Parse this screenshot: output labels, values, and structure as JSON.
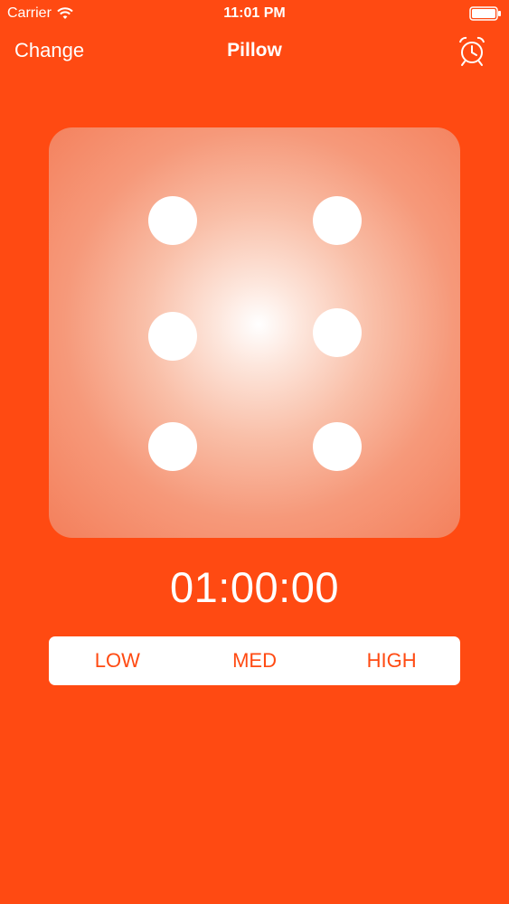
{
  "status_bar": {
    "carrier": "Carrier",
    "time": "11:01 PM",
    "wifi_icon": "wifi-icon",
    "battery_icon": "battery-icon"
  },
  "nav": {
    "left_button": "Change",
    "title": "Pillow",
    "right_icon": "alarm-clock-icon"
  },
  "dice": {
    "face_value": 6
  },
  "timer": {
    "value": "01:00:00"
  },
  "intensity": {
    "options": [
      "LOW",
      "MED",
      "HIGH"
    ]
  },
  "colors": {
    "background": "#FF4A12",
    "foreground": "#FFFFFF"
  }
}
